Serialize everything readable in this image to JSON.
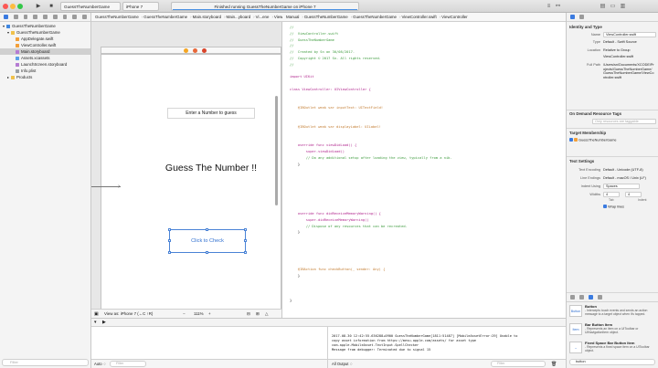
{
  "toolbar": {
    "run_icon": "play-icon",
    "stop_icon": "stop-icon",
    "scheme": "GuessTheNumberGame",
    "device": "iPhone 7",
    "status": "Finished running GuessTheNumberGame on iPhone 7"
  },
  "navigator": {
    "items": [
      {
        "label": "GuessTheNumberGame",
        "kind": "proj"
      },
      {
        "label": "GuessTheNumberGame",
        "kind": "folder"
      },
      {
        "label": "AppDelegate.swift",
        "kind": "swift"
      },
      {
        "label": "ViewController.swift",
        "kind": "swift"
      },
      {
        "label": "Main.storyboard",
        "kind": "sb"
      },
      {
        "label": "Assets.xcassets",
        "kind": "asset"
      },
      {
        "label": "LaunchScreen.storyboard",
        "kind": "sb"
      },
      {
        "label": "Info.plist",
        "kind": "plist"
      },
      {
        "label": "Products",
        "kind": "folder"
      }
    ]
  },
  "jumpbar_left": {
    "items": [
      "GuessTheNumberGame",
      "GuessTheNumberGame",
      "Main.storyboard",
      "Main...yboard",
      "Vi...ene",
      "View Cont...troller",
      "View",
      "Click to Check"
    ]
  },
  "jumpbar_right": {
    "items": [
      "Manual",
      "GuessTheNumberGame",
      "GuessTheNumberGame",
      "ViewController.swift",
      "ViewController"
    ]
  },
  "storyboard": {
    "label_box": "Enter a Number to guess",
    "big_label": "Guess The Number !!",
    "button": "Click to Check",
    "footer_view_as": "View as: iPhone 7 (←C ↑R)",
    "footer_zoom": "111%"
  },
  "editor": {
    "lines": [
      "//",
      "//  ViewController.swift",
      "//  GuessTheNumberGame",
      "//",
      "//  Created by Sn on 30/08/2017.",
      "//  Copyright © 2017 Sn. All rights reserved.",
      "//",
      "",
      "import UIKit",
      "",
      "class ViewController: UIViewController {",
      "",
      "",
      "    @IBOutlet weak var inputText: UITextField!",
      "",
      "",
      "    @IBOutlet weak var displayLabel: UILabel!",
      "",
      "",
      "    override func viewDidLoad() {",
      "        super.viewDidLoad()",
      "        // Do any additional setup after loading the view, typically from a nib.",
      "    }",
      "",
      "",
      "",
      "",
      "",
      "",
      "",
      "    override func didReceiveMemoryWarning() {",
      "        super.didReceiveMemoryWarning()",
      "        // Dispose of any resources that can be recreated.",
      "    }",
      "",
      "",
      "",
      "",
      "",
      "    @IBAction func checkButton(_ sender: Any) {",
      "    }",
      "",
      "",
      "",
      "}"
    ]
  },
  "inspector": {
    "identity_title": "Identity and Type",
    "name_key": "Name",
    "name_val": "ViewController.swift",
    "type_key": "Type",
    "type_val": "Default - Swift Source",
    "location_key": "Location",
    "location_val": "Relative to Group",
    "location_file": "ViewController.swift",
    "fullpath_key": "Full Path",
    "fullpath_val": "/Users/sn/Documents/XCODE/Projects/GuessTheNumberGame/GuessTheNumberGame/ViewController.swift",
    "ondemand_title": "On Demand Resource Tags",
    "tags_placeholder": "Only resources are taggable",
    "membership_title": "Target Membership",
    "target": "GuessTheNumberGame",
    "textsettings_title": "Text Settings",
    "encoding_key": "Text Encoding",
    "encoding_val": "Default - Unicode (UTF-8)",
    "endings_key": "Line Endings",
    "endings_val": "Default - macOS / Unix (LF)",
    "indent_key": "Indent Using",
    "indent_val": "Spaces",
    "widths_key": "Widths",
    "tab_val": "4",
    "indent_num": "4",
    "tab_label": "Tab",
    "indent_label": "Indent",
    "wrap": "Wrap lines",
    "library": [
      {
        "icon": "Button",
        "title": "Button",
        "desc": "- Intercepts touch events and sends an action message to a target object when it's tapped."
      },
      {
        "icon": "Item",
        "title": "Bar Button Item",
        "desc": "- Represents an item on a UIToolbar or UINavigationItem object."
      },
      {
        "icon": "↔",
        "title": "Fixed Space Bar Button Item",
        "desc": "- Represents a fixed space item on a UIToolbar object."
      }
    ],
    "filter_val": "button"
  },
  "debug": {
    "console_lines": [
      "2017-08-30 12:42:55.636288+0900 GuessTheNumberGame[1811:51487] [MobileAssetError:29] Unable to",
      "copy asset information from https://mesu.apple.com/assets/ for asset type",
      "com.apple.MobileAsset.TextInput.SpellChecker",
      "Message from debugger: Terminated due to signal 15"
    ],
    "auto_label": "Auto ♢",
    "output_label": "All Output ♢",
    "filter_placeholder": "Filter"
  },
  "colors": {
    "accent": "#3b7be0",
    "comment": "#3e9b3e",
    "keyword": "#b1278e",
    "button_text": "#2f6fd0"
  }
}
